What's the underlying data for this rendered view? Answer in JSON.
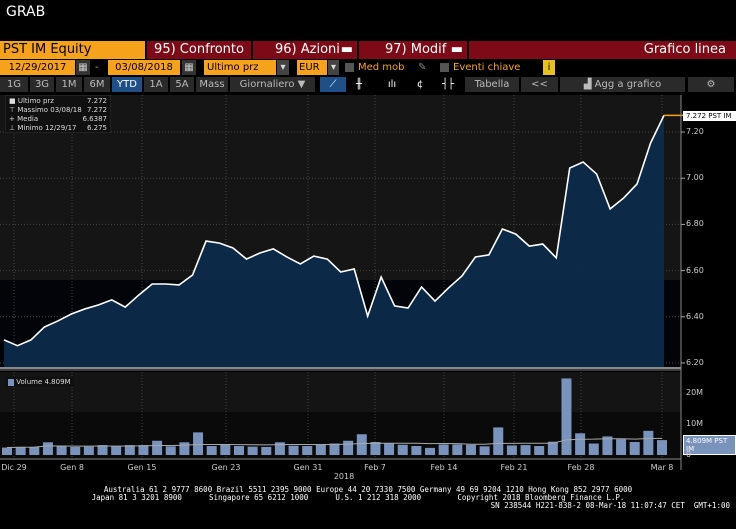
{
  "title": "GRAB",
  "toolbar1": {
    "security": "PST IM Equity",
    "compare": "95) Confronto",
    "actions": "96) Azioni",
    "edit": "97) Modif",
    "chart_type": "Grafico linea"
  },
  "toolbar2": {
    "start_date": "12/29/2017",
    "dash": "-",
    "end_date": "03/08/2018",
    "field": "Ultimo prz",
    "currency": "EUR",
    "moving_avg": "Med mob",
    "key_events": "Eventi chiave",
    "info": "i"
  },
  "toolbar3": {
    "periods": [
      "1G",
      "3G",
      "1M",
      "6M",
      "YTD",
      "1A",
      "5A",
      "Mass"
    ],
    "active": "YTD",
    "frequency": "Giornaliero ▼",
    "table": "Tabella",
    "collapse": "<<",
    "add_chart": "Agg a grafico"
  },
  "legend": [
    {
      "label": "Ultimo prz",
      "value": "7.272"
    },
    {
      "label": "Massimo 03/08/18",
      "value": "7.272"
    },
    {
      "label": "Media",
      "value": "6.6387"
    },
    {
      "label": "Minimo 12/29/17",
      "value": "6.275"
    }
  ],
  "volume_legend": "Volume 4.809M",
  "price_tag": "7.272 PST IM",
  "volume_tag": "4.809M PST IM",
  "colors": {
    "accent": "#f7a21b",
    "maroon": "#7d0a16",
    "area": "#0c2a4a",
    "bar": "#7a93bd"
  },
  "chart_data": [
    {
      "type": "area",
      "title": "PST IM Equity",
      "ylim": [
        6.2,
        7.3
      ],
      "yticks": [
        "6.20",
        "6.40",
        "6.60",
        "6.80",
        "7.00",
        "7.20"
      ],
      "values": [
        6.3,
        6.275,
        6.3,
        6.356,
        6.382,
        6.412,
        6.434,
        6.451,
        6.473,
        6.442,
        6.494,
        6.542,
        6.542,
        6.538,
        6.581,
        6.728,
        6.719,
        6.698,
        6.65,
        6.676,
        6.694,
        6.659,
        6.629,
        6.663,
        6.65,
        6.594,
        6.607,
        6.403,
        6.572,
        6.447,
        6.438,
        6.529,
        6.468,
        6.525,
        6.577,
        6.659,
        6.668,
        6.78,
        6.758,
        6.706,
        6.715,
        6.655,
        7.044,
        7.07,
        7.018,
        6.867,
        6.914,
        6.975,
        7.152,
        7.272
      ]
    },
    {
      "type": "bar",
      "title": "Volume",
      "unit": "M",
      "ylim": [
        0,
        26
      ],
      "yticks": [
        "0",
        "10M",
        "20M"
      ],
      "values": [
        2.4,
        2.6,
        2.6,
        4.1,
        2.9,
        2.6,
        2.7,
        3.2,
        2.8,
        3.2,
        3.2,
        4.6,
        2.8,
        4.1,
        7.3,
        2.9,
        3.3,
        2.9,
        2.7,
        2.6,
        4.1,
        3.0,
        2.9,
        3.5,
        3.7,
        4.6,
        6.7,
        4.2,
        3.8,
        3.3,
        2.9,
        2.3,
        3.4,
        3.4,
        3.3,
        2.8,
        8.9,
        3.1,
        3.2,
        2.9,
        4.3,
        24.7,
        7.0,
        3.7,
        6.0,
        5.1,
        4.2,
        7.8,
        4.809
      ]
    }
  ],
  "xaxis": {
    "labels": [
      "Dic 29",
      "Gen 8",
      "Gen 15",
      "Gen 23",
      "Gen 31",
      "Feb 7",
      "Feb 14",
      "Feb 21",
      "Feb 28",
      "Mar 8"
    ],
    "year": "2018"
  },
  "footer": [
    "Australia 61 2 9777 8600 Brazil 5511 2395 9000 Europe 44 20 7330 7500 Germany 49 69 9204 1210 Hong Kong 852 2977 6000",
    "Japan 81 3 3201 8900      Singapore 65 6212 1000      U.S. 1 212 318 2000        Copyright 2018 Bloomberg Finance L.P.",
    "SN 238544 H221-838-2 08-Mar-18 11:07:47 CET  GMT+1:00"
  ]
}
